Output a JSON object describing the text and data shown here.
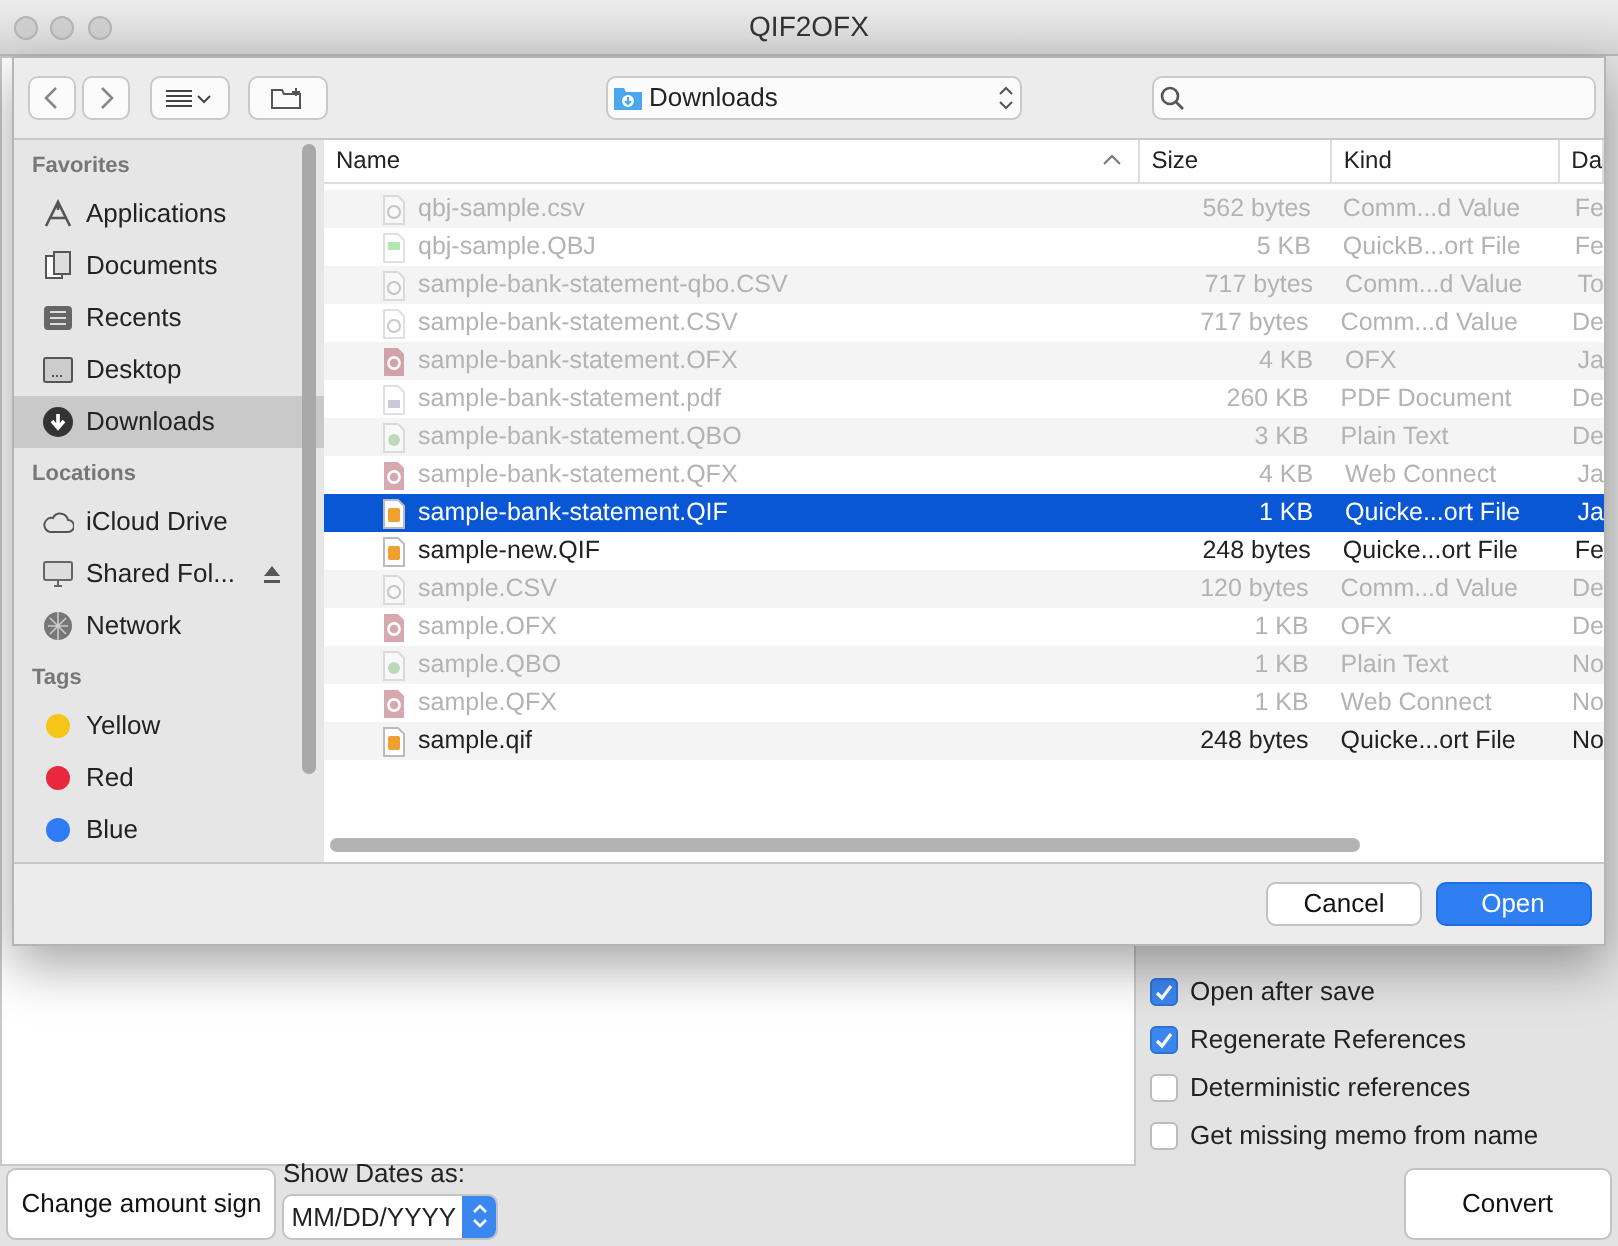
{
  "window": {
    "title": "QIF2OFX"
  },
  "dialog": {
    "location": "Downloads",
    "sidebar": [
      {
        "heading": "Favorites",
        "items": [
          {
            "label": "Applications",
            "kind": "apps",
            "selected": false
          },
          {
            "label": "Documents",
            "kind": "docs",
            "selected": false
          },
          {
            "label": "Recents",
            "kind": "recents",
            "selected": false
          },
          {
            "label": "Desktop",
            "kind": "desktop",
            "selected": false
          },
          {
            "label": "Downloads",
            "kind": "downloads",
            "selected": true
          }
        ]
      },
      {
        "heading": "Locations",
        "items": [
          {
            "label": "iCloud Drive",
            "kind": "cloud",
            "selected": false
          },
          {
            "label": "Shared Fol...",
            "kind": "display",
            "selected": false,
            "eject": true
          },
          {
            "label": "Network",
            "kind": "network",
            "selected": false
          }
        ]
      },
      {
        "heading": "Tags",
        "items": [
          {
            "label": "Yellow",
            "kind": "tag",
            "color": "#f5c518",
            "selected": false
          },
          {
            "label": "Red",
            "kind": "tag",
            "color": "#e8283c",
            "selected": false
          },
          {
            "label": "Blue",
            "kind": "tag",
            "color": "#2f7bf5",
            "selected": false
          }
        ]
      }
    ],
    "columns": [
      "Name",
      "Size",
      "Kind",
      "Da"
    ],
    "files": [
      {
        "name": "qbj-sample.csv",
        "size": "562 bytes",
        "kind_label": "Comm...d Value",
        "date": "Fe",
        "kind": "csv",
        "enabled": false,
        "selected": false
      },
      {
        "name": "qbj-sample.QBJ",
        "size": "5 KB",
        "kind_label": "QuickB...ort File",
        "date": "Fe",
        "kind": "qbj",
        "enabled": false,
        "selected": false
      },
      {
        "name": "sample-bank-statement-qbo.CSV",
        "size": "717 bytes",
        "kind_label": "Comm...d Value",
        "date": "To",
        "kind": "csv",
        "enabled": false,
        "selected": false
      },
      {
        "name": "sample-bank-statement.CSV",
        "size": "717 bytes",
        "kind_label": "Comm...d Value",
        "date": "De",
        "kind": "csv",
        "enabled": false,
        "selected": false
      },
      {
        "name": "sample-bank-statement.OFX",
        "size": "4 KB",
        "kind_label": "OFX",
        "date": "Ja",
        "kind": "ofx",
        "enabled": false,
        "selected": false
      },
      {
        "name": "sample-bank-statement.pdf",
        "size": "260 KB",
        "kind_label": "PDF Document",
        "date": "De",
        "kind": "pdf",
        "enabled": false,
        "selected": false
      },
      {
        "name": "sample-bank-statement.QBO",
        "size": "3 KB",
        "kind_label": "Plain Text",
        "date": "De",
        "kind": "qbo",
        "enabled": false,
        "selected": false
      },
      {
        "name": "sample-bank-statement.QFX",
        "size": "4 KB",
        "kind_label": "Web Connect",
        "date": "Ja",
        "kind": "ofx",
        "enabled": false,
        "selected": false
      },
      {
        "name": "sample-bank-statement.QIF",
        "size": "1 KB",
        "kind_label": "Quicke...ort File",
        "date": "Ja",
        "kind": "qif",
        "enabled": true,
        "selected": true
      },
      {
        "name": "sample-new.QIF",
        "size": "248 bytes",
        "kind_label": "Quicke...ort File",
        "date": "Fe",
        "kind": "qif",
        "enabled": true,
        "selected": false
      },
      {
        "name": "sample.CSV",
        "size": "120 bytes",
        "kind_label": "Comm...d Value",
        "date": "De",
        "kind": "csv",
        "enabled": false,
        "selected": false
      },
      {
        "name": "sample.OFX",
        "size": "1 KB",
        "kind_label": "OFX",
        "date": "De",
        "kind": "ofx",
        "enabled": false,
        "selected": false
      },
      {
        "name": "sample.QBO",
        "size": "1 KB",
        "kind_label": "Plain Text",
        "date": "No",
        "kind": "qbo",
        "enabled": false,
        "selected": false
      },
      {
        "name": "sample.QFX",
        "size": "1 KB",
        "kind_label": "Web Connect",
        "date": "No",
        "kind": "ofx",
        "enabled": false,
        "selected": false
      },
      {
        "name": "sample.qif",
        "size": "248 bytes",
        "kind_label": "Quicke...ort File",
        "date": "No",
        "kind": "qif",
        "enabled": true,
        "selected": false
      }
    ],
    "buttons": {
      "cancel": "Cancel",
      "open": "Open"
    }
  },
  "options": {
    "checkboxes": [
      {
        "label": "Open after save",
        "checked": true
      },
      {
        "label": "Regenerate References",
        "checked": true
      },
      {
        "label": "Deterministic references",
        "checked": false
      },
      {
        "label": "Get missing memo from name",
        "checked": false
      }
    ]
  },
  "bottom": {
    "sign_button": "Change amount sign",
    "dates_label": "Show Dates as:",
    "dates_value": "MM/DD/YYYY",
    "convert_button": "Convert"
  }
}
